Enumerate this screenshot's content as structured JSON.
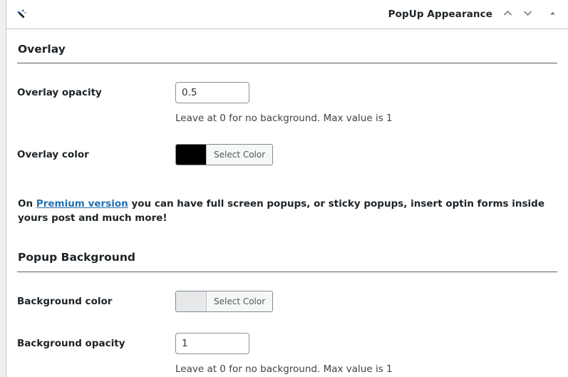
{
  "panel": {
    "header": {
      "icon": "magic-wand-icon",
      "title": "PopUp Appearance",
      "move_up_icon": "chevron-up-icon",
      "move_down_icon": "chevron-down-icon",
      "toggle_icon": "triangle-up-icon"
    },
    "sections": [
      {
        "title": "Overlay",
        "fields": [
          {
            "label": "Overlay opacity",
            "type": "number",
            "value": "0.5",
            "help": "Leave at 0 for no background. Max value is 1"
          },
          {
            "label": "Overlay color",
            "type": "color",
            "swatch": "#000000",
            "button_label": "Select Color"
          }
        ]
      },
      {
        "title": "Popup Background",
        "fields": [
          {
            "label": "Background color",
            "type": "color",
            "swatch": "#e7e8e9",
            "button_label": "Select Color"
          },
          {
            "label": "Background opacity",
            "type": "number",
            "value": "1",
            "help": "Leave at 0 for no background. Max value is 1"
          }
        ]
      }
    ],
    "promo": {
      "lead": "On ",
      "link": "Premium version",
      "rest": " you can have full screen popups, or sticky popups, insert optin forms inside yours post and much more!"
    }
  },
  "colors": {
    "link": "#2271b1",
    "text": "#1d2327",
    "border": "#c3c4c7",
    "rule": "#555d66"
  }
}
